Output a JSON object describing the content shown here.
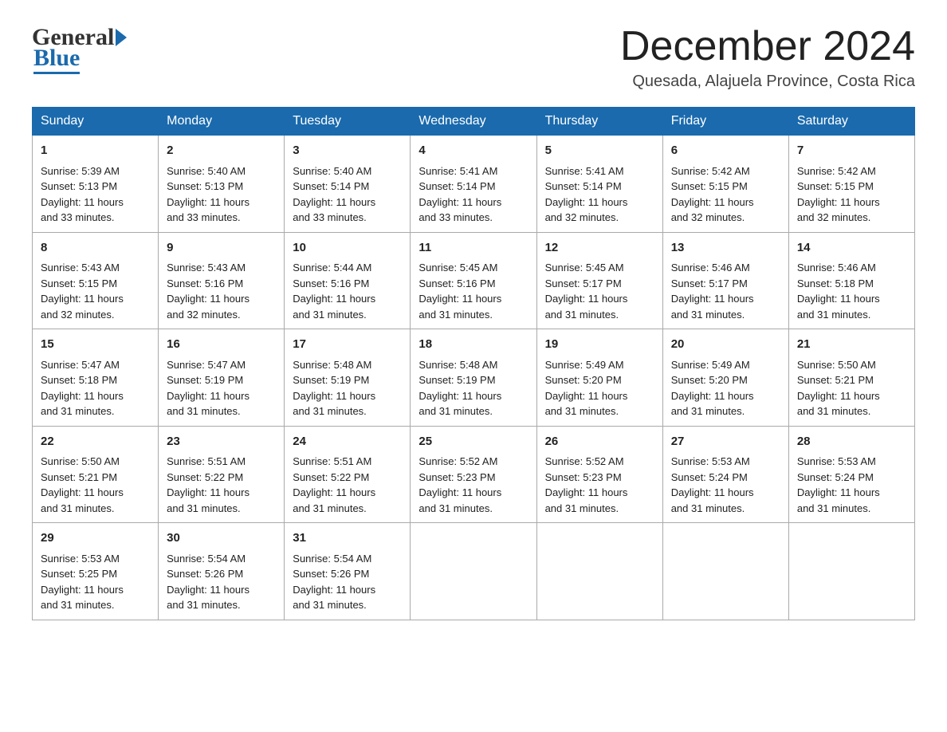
{
  "header": {
    "logo_general": "General",
    "logo_blue": "Blue",
    "month_title": "December 2024",
    "location": "Quesada, Alajuela Province, Costa Rica"
  },
  "calendar": {
    "days": [
      "Sunday",
      "Monday",
      "Tuesday",
      "Wednesday",
      "Thursday",
      "Friday",
      "Saturday"
    ],
    "weeks": [
      [
        {
          "day": 1,
          "sunrise": "5:39 AM",
          "sunset": "5:13 PM",
          "daylight": "11 hours and 33 minutes."
        },
        {
          "day": 2,
          "sunrise": "5:40 AM",
          "sunset": "5:13 PM",
          "daylight": "11 hours and 33 minutes."
        },
        {
          "day": 3,
          "sunrise": "5:40 AM",
          "sunset": "5:14 PM",
          "daylight": "11 hours and 33 minutes."
        },
        {
          "day": 4,
          "sunrise": "5:41 AM",
          "sunset": "5:14 PM",
          "daylight": "11 hours and 33 minutes."
        },
        {
          "day": 5,
          "sunrise": "5:41 AM",
          "sunset": "5:14 PM",
          "daylight": "11 hours and 32 minutes."
        },
        {
          "day": 6,
          "sunrise": "5:42 AM",
          "sunset": "5:15 PM",
          "daylight": "11 hours and 32 minutes."
        },
        {
          "day": 7,
          "sunrise": "5:42 AM",
          "sunset": "5:15 PM",
          "daylight": "11 hours and 32 minutes."
        }
      ],
      [
        {
          "day": 8,
          "sunrise": "5:43 AM",
          "sunset": "5:15 PM",
          "daylight": "11 hours and 32 minutes."
        },
        {
          "day": 9,
          "sunrise": "5:43 AM",
          "sunset": "5:16 PM",
          "daylight": "11 hours and 32 minutes."
        },
        {
          "day": 10,
          "sunrise": "5:44 AM",
          "sunset": "5:16 PM",
          "daylight": "11 hours and 31 minutes."
        },
        {
          "day": 11,
          "sunrise": "5:45 AM",
          "sunset": "5:16 PM",
          "daylight": "11 hours and 31 minutes."
        },
        {
          "day": 12,
          "sunrise": "5:45 AM",
          "sunset": "5:17 PM",
          "daylight": "11 hours and 31 minutes."
        },
        {
          "day": 13,
          "sunrise": "5:46 AM",
          "sunset": "5:17 PM",
          "daylight": "11 hours and 31 minutes."
        },
        {
          "day": 14,
          "sunrise": "5:46 AM",
          "sunset": "5:18 PM",
          "daylight": "11 hours and 31 minutes."
        }
      ],
      [
        {
          "day": 15,
          "sunrise": "5:47 AM",
          "sunset": "5:18 PM",
          "daylight": "11 hours and 31 minutes."
        },
        {
          "day": 16,
          "sunrise": "5:47 AM",
          "sunset": "5:19 PM",
          "daylight": "11 hours and 31 minutes."
        },
        {
          "day": 17,
          "sunrise": "5:48 AM",
          "sunset": "5:19 PM",
          "daylight": "11 hours and 31 minutes."
        },
        {
          "day": 18,
          "sunrise": "5:48 AM",
          "sunset": "5:19 PM",
          "daylight": "11 hours and 31 minutes."
        },
        {
          "day": 19,
          "sunrise": "5:49 AM",
          "sunset": "5:20 PM",
          "daylight": "11 hours and 31 minutes."
        },
        {
          "day": 20,
          "sunrise": "5:49 AM",
          "sunset": "5:20 PM",
          "daylight": "11 hours and 31 minutes."
        },
        {
          "day": 21,
          "sunrise": "5:50 AM",
          "sunset": "5:21 PM",
          "daylight": "11 hours and 31 minutes."
        }
      ],
      [
        {
          "day": 22,
          "sunrise": "5:50 AM",
          "sunset": "5:21 PM",
          "daylight": "11 hours and 31 minutes."
        },
        {
          "day": 23,
          "sunrise": "5:51 AM",
          "sunset": "5:22 PM",
          "daylight": "11 hours and 31 minutes."
        },
        {
          "day": 24,
          "sunrise": "5:51 AM",
          "sunset": "5:22 PM",
          "daylight": "11 hours and 31 minutes."
        },
        {
          "day": 25,
          "sunrise": "5:52 AM",
          "sunset": "5:23 PM",
          "daylight": "11 hours and 31 minutes."
        },
        {
          "day": 26,
          "sunrise": "5:52 AM",
          "sunset": "5:23 PM",
          "daylight": "11 hours and 31 minutes."
        },
        {
          "day": 27,
          "sunrise": "5:53 AM",
          "sunset": "5:24 PM",
          "daylight": "11 hours and 31 minutes."
        },
        {
          "day": 28,
          "sunrise": "5:53 AM",
          "sunset": "5:24 PM",
          "daylight": "11 hours and 31 minutes."
        }
      ],
      [
        {
          "day": 29,
          "sunrise": "5:53 AM",
          "sunset": "5:25 PM",
          "daylight": "11 hours and 31 minutes."
        },
        {
          "day": 30,
          "sunrise": "5:54 AM",
          "sunset": "5:26 PM",
          "daylight": "11 hours and 31 minutes."
        },
        {
          "day": 31,
          "sunrise": "5:54 AM",
          "sunset": "5:26 PM",
          "daylight": "11 hours and 31 minutes."
        },
        null,
        null,
        null,
        null
      ]
    ],
    "labels": {
      "sunrise": "Sunrise:",
      "sunset": "Sunset:",
      "daylight": "Daylight:"
    }
  }
}
